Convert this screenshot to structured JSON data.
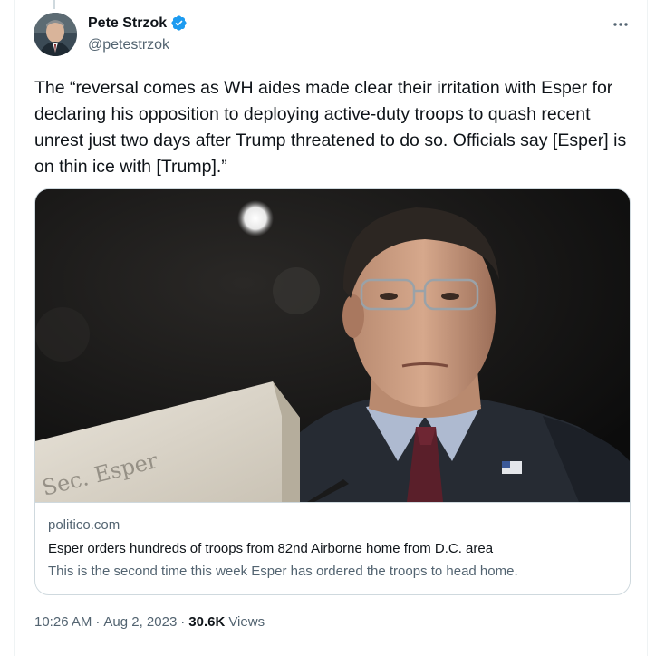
{
  "tweet": {
    "display_name": "Pete Strzok",
    "handle": "@petestrzok",
    "text": "The “reversal comes as WH aides made clear their irritation with Esper for declaring his opposition to deploying active-duty troops to quash recent unrest just two days after Trump threatened to do so. Officials say [Esper] is on thin ice with [Trump].”",
    "time": "10:26 AM",
    "separator": "·",
    "date": "Aug 2, 2023",
    "views_count": "30.6K",
    "views_label": "Views"
  },
  "card": {
    "domain": "politico.com",
    "title": "Esper orders hundreds of troops from 82nd Airborne home from D.C. area",
    "description": "This is the second time this week Esper has ordered the troops to head home.",
    "nameplate_text": "Sec. Esper"
  },
  "icons": {
    "verified": "verified-badge-icon",
    "more": "more-dots-icon"
  },
  "colors": {
    "verified_blue": "#1d9bf0",
    "text_primary": "#0f1419",
    "text_secondary": "#536471",
    "border": "#cfd9de"
  }
}
